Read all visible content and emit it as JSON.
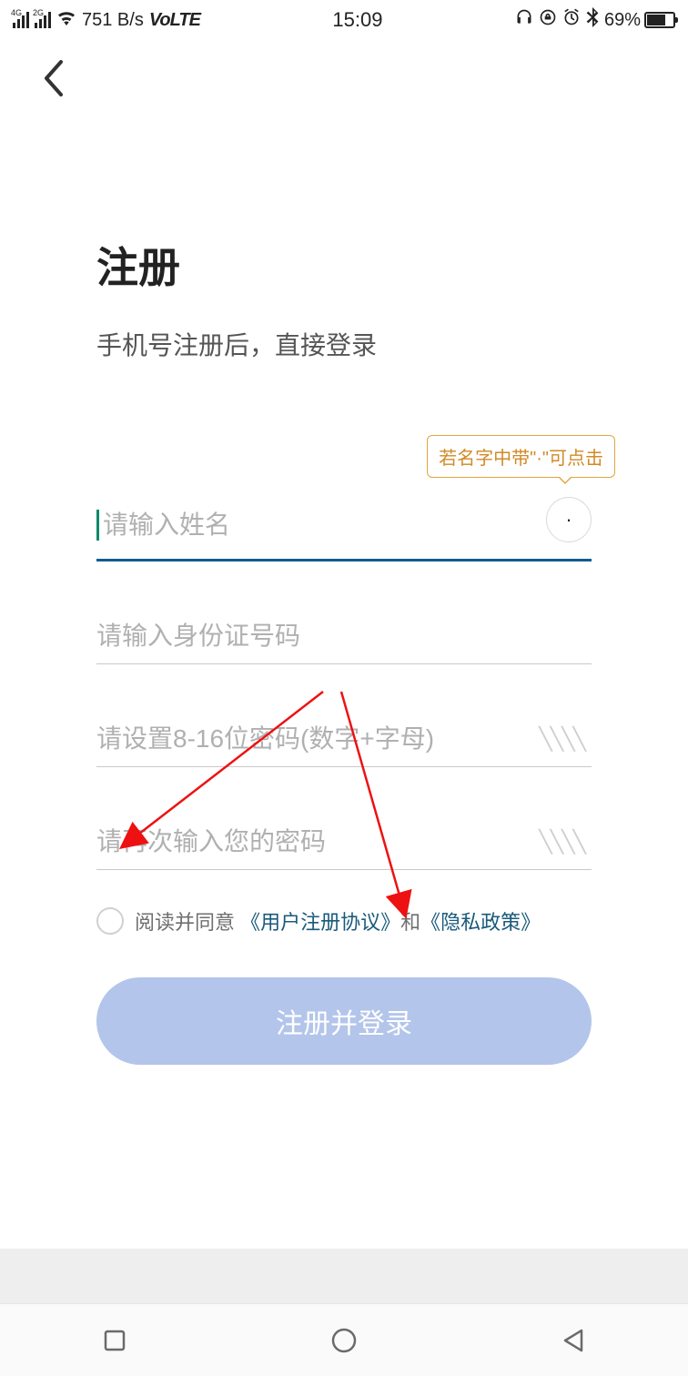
{
  "status": {
    "sig1_label": "4G",
    "sig2_label": "2G",
    "speed": "751 B/s",
    "volte": "VoLTE",
    "time": "15:09",
    "battery_pct": "69%"
  },
  "page": {
    "title": "注册",
    "subtitle": "手机号注册后，直接登录",
    "name_tooltip": "若名字中带\"·\"可点击",
    "dot_char": "·",
    "fields": {
      "name_placeholder": "请输入姓名",
      "id_placeholder": "请输入身份证号码",
      "pwd_placeholder": "请设置8-16位密码(数字+字母)",
      "pwd2_placeholder": "请再次输入您的密码"
    },
    "agreement": {
      "prefix": "阅读并同意",
      "link1": "《用户注册协议》",
      "mid": "和",
      "link2": "《隐私政策》"
    },
    "submit_label": "注册并登录"
  }
}
